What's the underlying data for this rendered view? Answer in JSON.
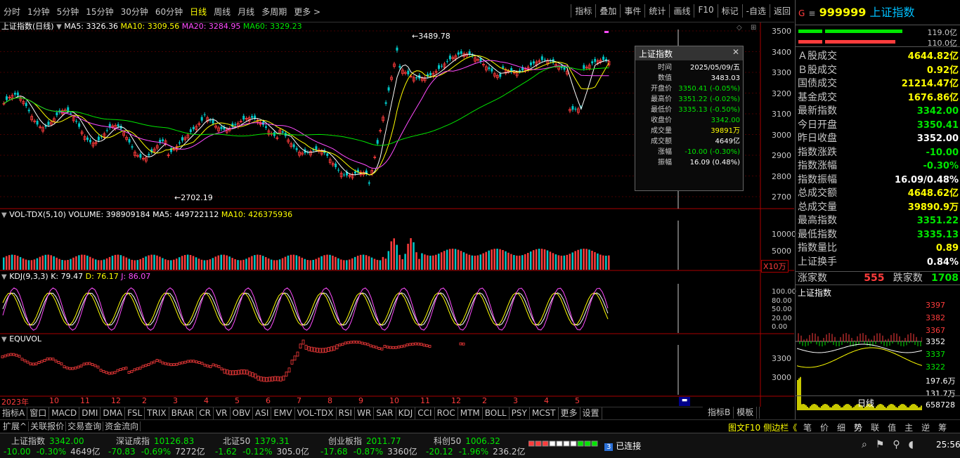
{
  "toolbar": {
    "periods": [
      "分时",
      "1分钟",
      "5分钟",
      "15分钟",
      "30分钟",
      "60分钟",
      "日线",
      "周线",
      "月线",
      "多周期",
      "更多 >"
    ],
    "active_period": "日线",
    "right_buttons": [
      "指标",
      "叠加",
      "事件",
      "统计",
      "画线",
      "F10",
      "标记",
      "-自选",
      "返回"
    ]
  },
  "main_chart": {
    "title": "上证指数(日线)",
    "ma5": "MA5: 3326.36",
    "ma10": "MA10: 3309.56",
    "ma20": "MA20: 3284.95",
    "ma60": "MA60: 3329.23",
    "high_label": "3489.78",
    "low_label": "2702.19",
    "y_ticks": [
      "3500",
      "3400",
      "3300",
      "3200",
      "3100",
      "3000",
      "2900",
      "2800",
      "2700"
    ]
  },
  "vol_panel": {
    "title": "VOL-TDX(5,10) VOLUME: 398909184",
    "ma5": "MA5: 449722112",
    "ma10": "MA10: 426375936",
    "y_ticks": [
      "10000",
      "5000"
    ],
    "unit": "X10万"
  },
  "kdj_panel": {
    "title": "KDJ(9,3,3)",
    "k": "K: 79.47",
    "d": "D: 76.17",
    "j": "J: 86.07",
    "y_ticks": [
      "100.00",
      "80.00",
      "50.00",
      "20.00",
      "0.00"
    ]
  },
  "equvol_panel": {
    "title": "EQUVOL",
    "y_ticks": [
      "3300",
      "3000"
    ]
  },
  "x_axis": {
    "year_label": "2023年",
    "months": [
      "10",
      "11",
      "12",
      "2",
      "3",
      "4",
      "5",
      "6",
      "7",
      "8",
      "9",
      "10",
      "11",
      "12",
      "2",
      "3",
      "4",
      "5"
    ]
  },
  "popup": {
    "title": "上证指数",
    "rows": [
      {
        "k": "时间",
        "v": "2025/05/09/五",
        "c": "white"
      },
      {
        "k": "数值",
        "v": "3483.03",
        "c": "white"
      },
      {
        "k": "开盘价",
        "v": "3350.41 (-0.05%)",
        "c": "green"
      },
      {
        "k": "最高价",
        "v": "3351.22 (-0.02%)",
        "c": "green"
      },
      {
        "k": "最低价",
        "v": "3335.13 (-0.50%)",
        "c": "green"
      },
      {
        "k": "收盘价",
        "v": "3342.00",
        "c": "green"
      },
      {
        "k": "成交量",
        "v": "39891万",
        "c": "yellow"
      },
      {
        "k": "成交额",
        "v": "4649亿",
        "c": "white"
      },
      {
        "k": "涨幅",
        "v": "-10.00 (-0.30%)",
        "c": "green"
      },
      {
        "k": "振幅",
        "v": "16.09 (0.48%)",
        "c": "white"
      }
    ]
  },
  "right_panel": {
    "code": "999999",
    "name": "上证指数",
    "bar1_val": "119.0亿",
    "bar2_val": "110.0亿",
    "rows": [
      {
        "k": "Ａ股成交",
        "v": "4644.82亿",
        "c": "yellow"
      },
      {
        "k": "Ｂ股成交",
        "v": "0.92亿",
        "c": "yellow"
      },
      {
        "k": "国债成交",
        "v": "21214.47亿",
        "c": "yellow"
      },
      {
        "k": "基金成交",
        "v": "1676.86亿",
        "c": "yellow"
      },
      {
        "k": "最新指数",
        "v": "3342.00",
        "c": "green"
      },
      {
        "k": "今日开盘",
        "v": "3350.41",
        "c": "green"
      },
      {
        "k": "昨日收盘",
        "v": "3352.00",
        "c": "white"
      },
      {
        "k": "指数涨跌",
        "v": "-10.00",
        "c": "green"
      },
      {
        "k": "指数涨幅",
        "v": "-0.30%",
        "c": "green"
      },
      {
        "k": "指数振幅",
        "v": "16.09/0.48%",
        "c": "white"
      },
      {
        "k": "总成交额",
        "v": "4648.62亿",
        "c": "yellow"
      },
      {
        "k": "总成交量",
        "v": "39890.9万",
        "c": "yellow"
      },
      {
        "k": "最高指数",
        "v": "3351.22",
        "c": "green"
      },
      {
        "k": "最低指数",
        "v": "3335.13",
        "c": "green"
      },
      {
        "k": "指数量比",
        "v": "0.89",
        "c": "yellow"
      },
      {
        "k": "上证换手",
        "v": "0.84%",
        "c": "white"
      }
    ],
    "rise_label": "涨家数",
    "rise": "555",
    "fall_label": "跌家数",
    "fall": "1708",
    "mini_title": "上证指数",
    "mini_ticks": [
      "3397",
      "3382",
      "3367",
      "3352",
      "3337",
      "3322",
      "197.6万",
      "131.7万",
      "658728"
    ],
    "mini_tab": "日线"
  },
  "indicator_tabs": [
    "指标A",
    "窗口",
    "MACD",
    "DMI",
    "DMA",
    "FSL",
    "TRIX",
    "BRAR",
    "CR",
    "VR",
    "OBV",
    "ASI",
    "EMV",
    "VOL-TDX",
    "RSI",
    "WR",
    "SAR",
    "KDJ",
    "CCI",
    "ROC",
    "MTM",
    "BOLL",
    "PSY",
    "MCST",
    "更多",
    "设置"
  ],
  "indicator_tabs_right": [
    "指标B",
    "模板"
  ],
  "bottom_tabs": [
    "扩展^",
    "关联报价",
    "交易查询",
    "资金流向"
  ],
  "bottom_right_tabs": [
    "图文F10",
    "侧边栏《"
  ],
  "side_tabs": [
    "笔",
    "价",
    "细",
    "势",
    "联",
    "值",
    "主",
    "逆",
    "筹"
  ],
  "status": [
    {
      "name": "上证指数",
      "val": "3342.00",
      "chg": "-10.00",
      "pct": "-0.30%",
      "amt": "4649亿"
    },
    {
      "name": "深证成指",
      "val": "10126.83",
      "chg": "-70.83",
      "pct": "-0.69%",
      "amt": "7272亿"
    },
    {
      "name": "北证50",
      "val": "1379.31",
      "chg": "-1.62",
      "pct": "-0.12%",
      "amt": "305.0亿"
    },
    {
      "name": "创业板指",
      "val": "2011.77",
      "chg": "-17.68",
      "pct": "-0.87%",
      "amt": "3360亿"
    },
    {
      "name": "科创50",
      "val": "1006.32",
      "chg": "-20.12",
      "pct": "-1.96%",
      "amt": "236.2亿"
    }
  ],
  "connect": "已连接",
  "connect_num": "3",
  "clock": "25:56"
}
